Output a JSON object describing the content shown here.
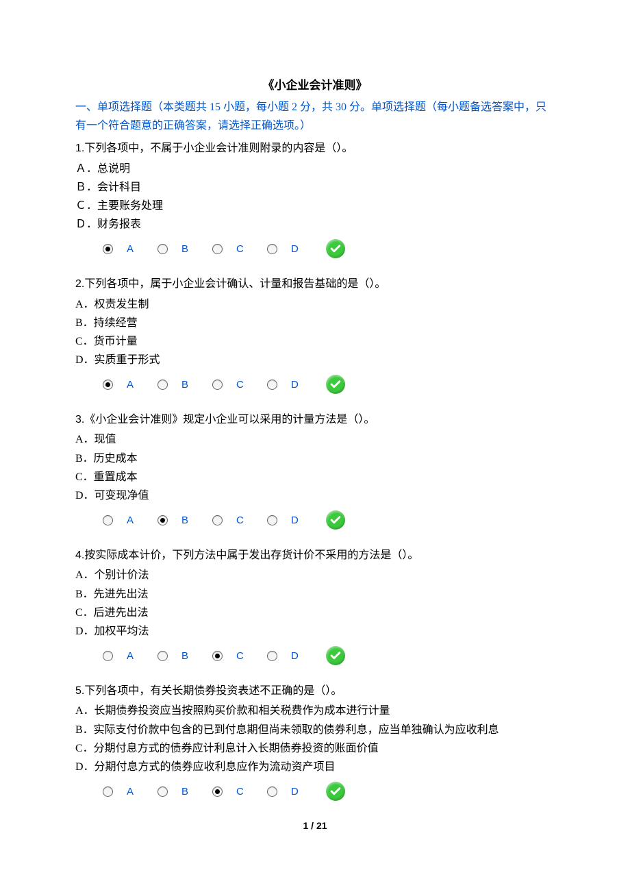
{
  "title": "《小企业会计准则》",
  "section_desc": "一、单项选择题（本类题共 15 小题，每小题 2 分，共 30 分。单项选择题（每小题备选答案中，只有一个符合题意的正确答案，请选择正确选项。）",
  "questions": [
    {
      "num": "1.",
      "text": "下列各项中，不属于小企业会计准则附录的内容是（）。",
      "opts": [
        "Ａ．总说明",
        "Ｂ．会计科目",
        "Ｃ．主要账务处理",
        "Ｄ．财务报表"
      ],
      "selected": 0
    },
    {
      "num": "2.",
      "text": "下列各项中，属于小企业会计确认、计量和报告基础的是（）。",
      "opts": [
        "A．权责发生制",
        "B．持续经营",
        "C．货币计量",
        "D．实质重于形式"
      ],
      "selected": 0
    },
    {
      "num": "3.",
      "text": "《小企业会计准则》规定小企业可以采用的计量方法是（）。",
      "opts": [
        "A．现值",
        "B．历史成本",
        "C．重置成本",
        "D．可变现净值"
      ],
      "selected": 1
    },
    {
      "num": "4.",
      "text": "按实际成本计价，下列方法中属于发出存货计价不采用的方法是（）。",
      "opts": [
        "A．个别计价法",
        "B．先进先出法",
        "C．后进先出法",
        "D．加权平均法"
      ],
      "selected": 2
    },
    {
      "num": "5.",
      "text": "下列各项中，有关长期债券投资表述不正确的是（）。",
      "opts": [
        "A．长期债券投资应当按照购买价款和相关税费作为成本进行计量",
        "B．实际支付价款中包含的已到付息期但尚未领取的债券利息，应当单独确认为应收利息",
        "C．分期付息方式的债券应计利息计入长期债券投资的账面价值",
        "D．分期付息方式的债券应收利息应作为流动资产项目"
      ],
      "selected": 2
    }
  ],
  "letters": [
    "A",
    "B",
    "C",
    "D"
  ],
  "pager": "1 / 21"
}
